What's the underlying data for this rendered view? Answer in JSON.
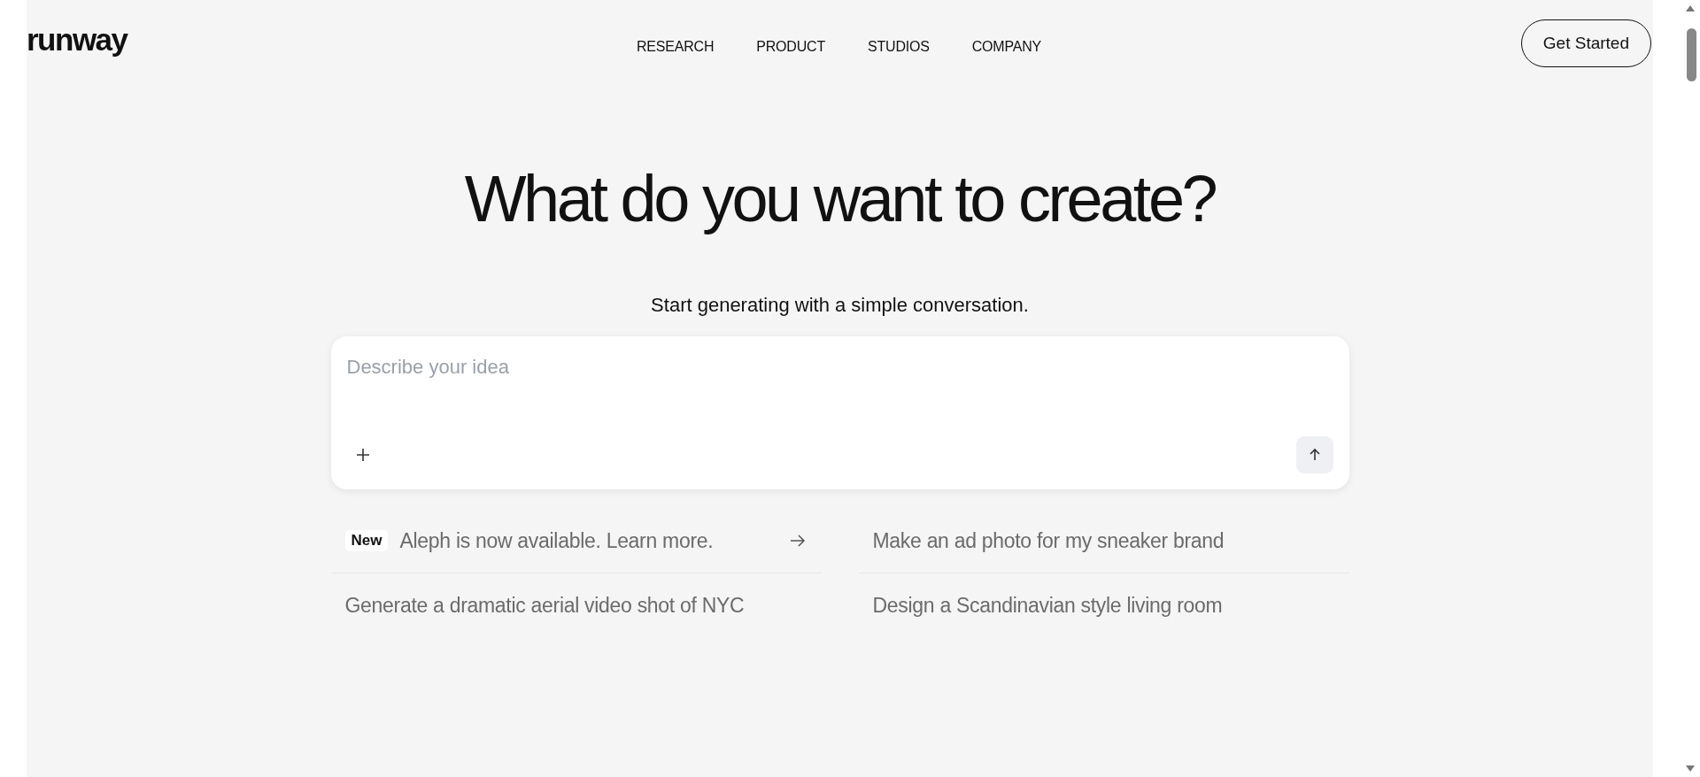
{
  "logo": "runway",
  "nav": [
    {
      "label": "RESEARCH"
    },
    {
      "label": "PRODUCT"
    },
    {
      "label": "STUDIOS"
    },
    {
      "label": "COMPANY"
    }
  ],
  "cta": "Get Started",
  "heading": "What do you want to create?",
  "subheading": "Start generating with a simple conversation.",
  "prompt": {
    "placeholder": "Describe your idea"
  },
  "suggestions": [
    {
      "kind": "announcement",
      "badge": "New",
      "text": "Aleph is now available. Learn more."
    },
    {
      "kind": "prompt",
      "text": "Make an ad photo for my sneaker brand"
    },
    {
      "kind": "prompt",
      "text": "Generate a dramatic aerial video shot of NYC"
    },
    {
      "kind": "prompt",
      "text": "Design a Scandinavian style living room"
    }
  ]
}
